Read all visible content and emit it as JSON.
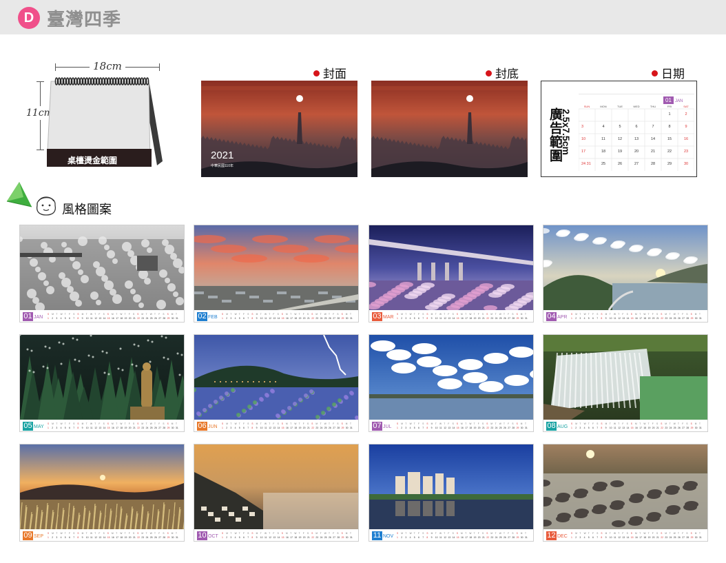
{
  "header": {
    "badge": "D",
    "title": "臺灣四季"
  },
  "desk_calendar": {
    "width_label": "18cm",
    "height_label": "11cm",
    "base_label": "桌檯燙金範圍"
  },
  "previews": {
    "cover_label": "封面",
    "back_label": "封底",
    "date_label": "日期",
    "cover_year": "2021",
    "cover_roc": "中華民國110年",
    "date_panel": {
      "ad_area": "廣告範圍",
      "ad_size": "2.5x7.5cm",
      "month_no": "01",
      "month_name": "JAN",
      "weekdays": [
        "SUN",
        "MON",
        "TUE",
        "WED",
        "THU",
        "FRI",
        "SAT"
      ],
      "weeks": [
        [
          "",
          "",
          "",
          "",
          "",
          "1",
          "2"
        ],
        [
          "3",
          "4",
          "5",
          "6",
          "7",
          "8",
          "9"
        ],
        [
          "10",
          "11",
          "12",
          "13",
          "14",
          "15",
          "16"
        ],
        [
          "17",
          "18",
          "19",
          "20",
          "21",
          "22",
          "23"
        ],
        [
          "24 31",
          "25",
          "26",
          "27",
          "28",
          "29",
          "30"
        ]
      ]
    }
  },
  "style_section": {
    "title": "風格圖案"
  },
  "months": [
    {
      "no": "01",
      "name": "JAN",
      "color": "#a05ab0",
      "theme": "snow"
    },
    {
      "no": "02",
      "name": "FEB",
      "color": "#1f7fd0",
      "theme": "sunset"
    },
    {
      "no": "03",
      "name": "MAR",
      "color": "#e85a3b",
      "theme": "bridge"
    },
    {
      "no": "04",
      "name": "APR",
      "color": "#a05ab0",
      "theme": "lake"
    },
    {
      "no": "05",
      "name": "MAY",
      "color": "#1aa3a3",
      "theme": "forest"
    },
    {
      "no": "06",
      "name": "JUN",
      "color": "#e8782a",
      "theme": "lightning"
    },
    {
      "no": "07",
      "name": "JUL",
      "color": "#a05ab0",
      "theme": "clouds"
    },
    {
      "no": "08",
      "name": "AUG",
      "color": "#1aa3a3",
      "theme": "waterfall"
    },
    {
      "no": "09",
      "name": "SEP",
      "color": "#e8782a",
      "theme": "golden"
    },
    {
      "no": "10",
      "name": "OCT",
      "color": "#a05ab0",
      "theme": "fog"
    },
    {
      "no": "11",
      "name": "NOV",
      "color": "#1f7fd0",
      "theme": "city"
    },
    {
      "no": "12",
      "name": "DEC",
      "color": "#e85a3b",
      "theme": "stream"
    }
  ]
}
